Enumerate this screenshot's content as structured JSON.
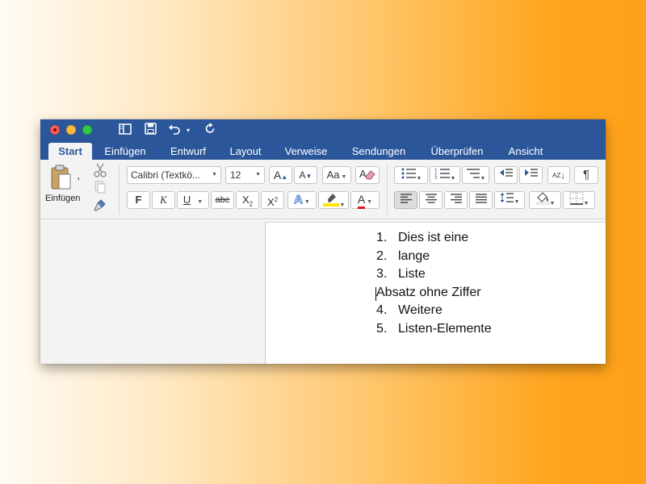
{
  "toolbar": {
    "undo_icon": "undo-icon",
    "redo_icon": "repeat-icon"
  },
  "tabs": [
    {
      "label": "Start",
      "active": true
    },
    {
      "label": "Einfügen"
    },
    {
      "label": "Entwurf"
    },
    {
      "label": "Layout"
    },
    {
      "label": "Verweise"
    },
    {
      "label": "Sendungen"
    },
    {
      "label": "Überprüfen"
    },
    {
      "label": "Ansicht"
    }
  ],
  "clipboard": {
    "paste_label": "Einfügen"
  },
  "font": {
    "family": "Calibri (Textkö...",
    "size": "12",
    "grow": "A",
    "shrink": "A",
    "case": "Aa",
    "bold": "F",
    "italic": "K",
    "underline": "U",
    "strike": "abc",
    "subscript": "X",
    "subscript_mark": "2",
    "superscript": "X",
    "superscript_mark": "2",
    "effects": "A",
    "color": "A",
    "highlight_color": "#ffe600",
    "font_color": "#e0141e"
  },
  "paragraph": {
    "pilcrow": "¶",
    "sort": "AZ",
    "alignment_active": "left"
  },
  "document": {
    "lines": [
      {
        "num": "1.",
        "text": "Dies ist eine"
      },
      {
        "num": "2.",
        "text": "lange"
      },
      {
        "num": "3.",
        "text": "Liste"
      },
      {
        "num": "",
        "text": "Absatz ohne Ziffer"
      },
      {
        "num": "4.",
        "text": "Weitere"
      },
      {
        "num": "5.",
        "text": "Listen-Elemente"
      }
    ]
  },
  "colors": {
    "title_bar": "#2b579a",
    "ribbon": "#f3f3f3"
  }
}
